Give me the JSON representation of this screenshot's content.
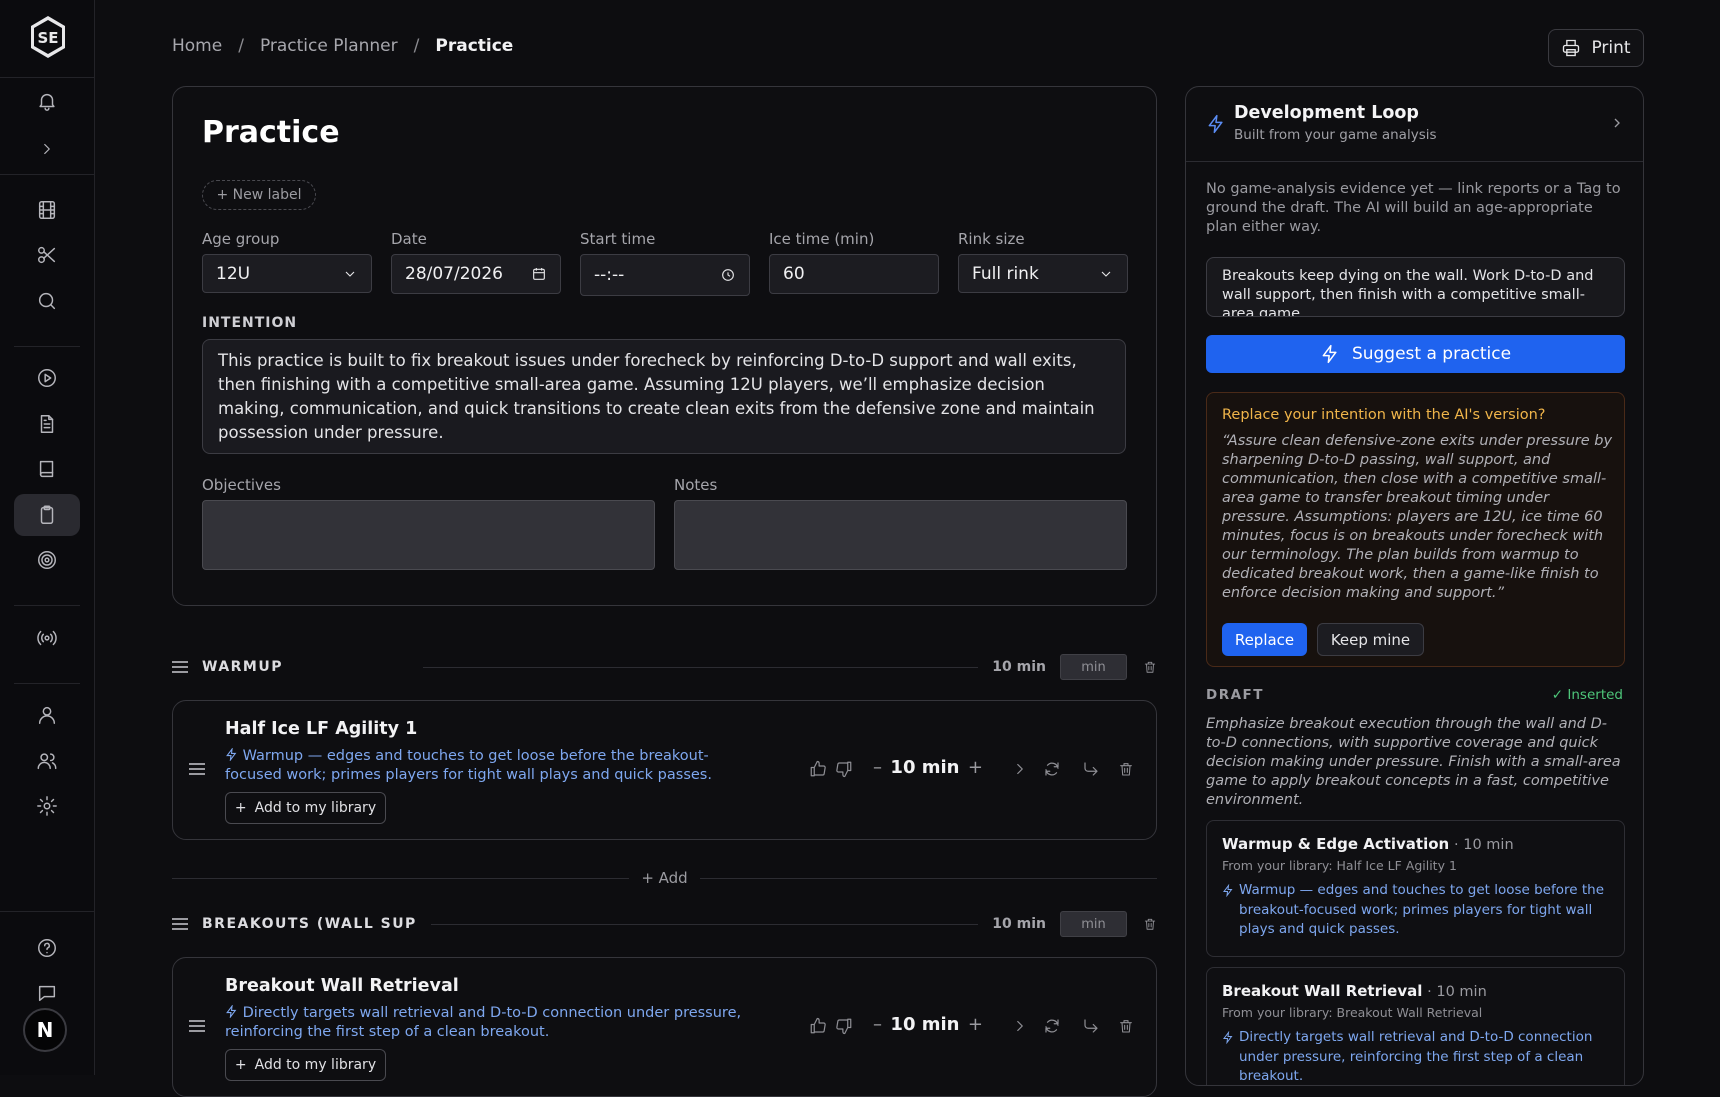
{
  "sidebar": {
    "logo_text": "SE",
    "avatar_letter": "N"
  },
  "breadcrumb": {
    "home": "Home",
    "planner": "Practice Planner",
    "current": "Practice"
  },
  "print_label": "Print",
  "practice": {
    "title": "Practice",
    "new_label": "+ New label",
    "fields": {
      "age_group_label": "Age group",
      "age_group_value": "12U",
      "date_label": "Date",
      "date_value": "28/07/2026",
      "start_label": "Start time",
      "start_value": "--:--",
      "ice_label": "Ice time (min)",
      "ice_value": "60",
      "rink_label": "Rink size",
      "rink_value": "Full rink"
    },
    "intention_label": "INTENTION",
    "intention_text": "This practice is built to fix breakout issues under forecheck by reinforcing D-to-D support and wall exits, then finishing with a competitive small-area game. Assuming 12U players, we’ll emphasize decision making, communication, and quick transitions to create clean exits from the defensive zone and maintain possession under pressure.",
    "objectives_label": "Objectives",
    "notes_label": "Notes"
  },
  "sections": [
    {
      "title": "WARMUP",
      "minutes": "10 min",
      "min_placeholder": "min",
      "drill": {
        "title": "Half Ice LF Agility 1",
        "why": "Warmup — edges and touches to get loose before the breakout-focused work; primes players for tight wall plays and quick passes.",
        "add_label": "Add to my library",
        "duration": "10 min"
      }
    },
    {
      "title": "BREAKOUTS (WALL SUP",
      "minutes": "10 min",
      "min_placeholder": "min",
      "drill": {
        "title": "Breakout Wall Retrieval",
        "why": "Directly targets wall retrieval and D-to-D connection under pressure, reinforcing the first step of a clean breakout.",
        "add_label": "Add to my library",
        "duration": "10 min"
      }
    }
  ],
  "add_row_label": "+ Add",
  "dev_loop": {
    "title": "Development Loop",
    "subtitle": "Built from your game analysis",
    "note": "No game-analysis evidence yet — link reports or a Tag to ground the draft. The AI will build an age-appropriate plan either way.",
    "prompt_text": "Breakouts keep dying on the wall. Work D-to-D and wall support, then finish with a competitive small-area game.",
    "suggest_label": "Suggest a practice",
    "replace_question": "Replace your intention with the AI's version?",
    "replace_text": "“Assure clean defensive-zone exits under pressure by sharpening D-to-D passing, wall support, and communication, then close with a competitive small-area game to transfer breakout timing under pressure. Assumptions: players are 12U, ice time 60 minutes, focus is on breakouts under forecheck with our terminology. The plan builds from warmup to dedicated breakout work, then a game-like finish to enforce decision making and support.”",
    "replace_btn": "Replace",
    "keep_btn": "Keep mine",
    "draft_label": "DRAFT",
    "inserted_label": "✓ Inserted",
    "draft_text": "Emphasize breakout execution through the wall and D-to-D connections, with supportive coverage and quick decision making under pressure. Finish with a small-area game to apply breakout concepts in a fast, competitive environment.",
    "draft_items": [
      {
        "title": "Warmup & Edge Activation",
        "duration": "· 10 min",
        "from": "From your library: Half Ice LF Agility 1",
        "why": "Warmup — edges and touches to get loose before the breakout-focused work; primes players for tight wall plays and quick passes."
      },
      {
        "title": "Breakout Wall Retrieval",
        "duration": "· 10 min",
        "from": "From your library: Breakout Wall Retrieval",
        "why": "Directly targets wall retrieval and D-to-D connection under pressure, reinforcing the first step of a clean breakout."
      }
    ]
  },
  "colors": {
    "accent": "#1f63ef",
    "ai_blue": "#7ea7ef",
    "warning": "#f0b54a",
    "success": "#4ec67a"
  }
}
